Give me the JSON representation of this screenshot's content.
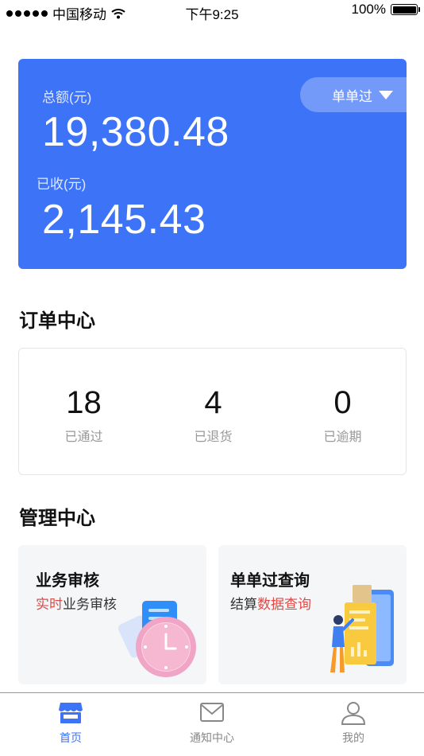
{
  "status_bar": {
    "carrier": "中国移动",
    "time": "下午9:25",
    "battery": "100%"
  },
  "balance": {
    "total_label": "总额(元)",
    "total_value": "19,380.48",
    "received_label": "已收(元)",
    "received_value": "2,145.43",
    "filter_label": "单单过"
  },
  "order_center": {
    "title": "订单中心",
    "stats": [
      {
        "value": "18",
        "label": "已通过"
      },
      {
        "value": "4",
        "label": "已退货"
      },
      {
        "value": "0",
        "label": "已逾期"
      }
    ]
  },
  "management": {
    "title": "管理中心",
    "cards": [
      {
        "title": "业务审核",
        "sub_highlight": "实时",
        "sub_rest": "业务审核"
      },
      {
        "title": "单单过查询",
        "sub_prefix": "结算",
        "sub_highlight": "数据查询"
      }
    ]
  },
  "tabbar": {
    "items": [
      {
        "label": "首页",
        "icon": "store-icon"
      },
      {
        "label": "通知中心",
        "icon": "mail-icon"
      },
      {
        "label": "我的",
        "icon": "user-icon"
      }
    ]
  },
  "colors": {
    "brand": "#3d73f7",
    "highlight": "#e04b48"
  }
}
